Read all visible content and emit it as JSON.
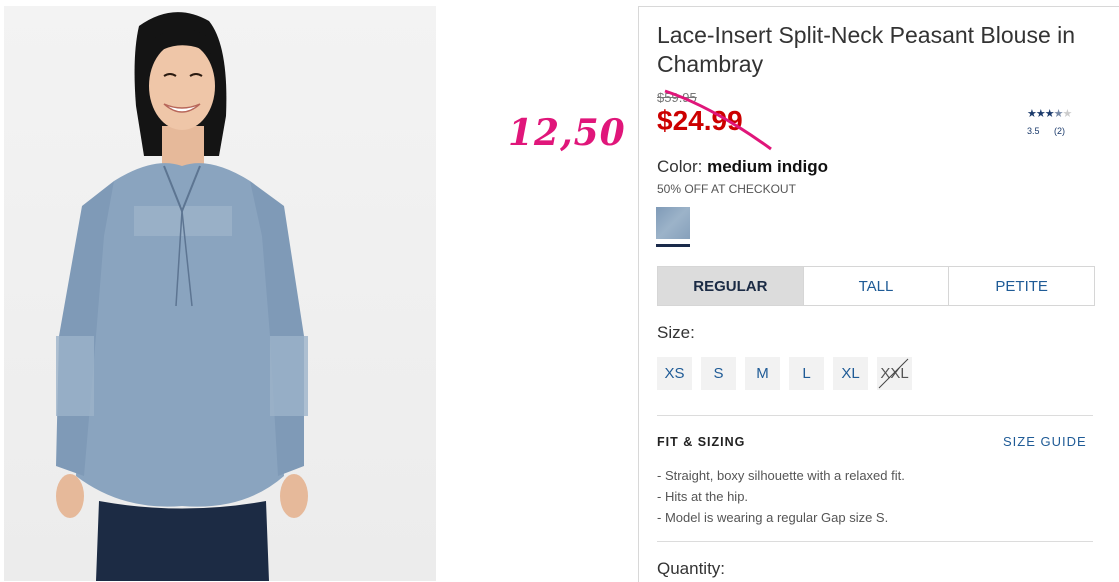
{
  "product": {
    "title": "Lace-Insert Split-Neck Peasant Blouse in Chambray",
    "original_price": "$59.95",
    "sale_price": "$24.99",
    "handwritten_price": "12,50",
    "rating": {
      "value": "3.5",
      "count": "(2)",
      "stars_filled": 3.5,
      "stars_total": 5
    },
    "color_label": "Color:",
    "color_name": "medium indigo",
    "promo": "50% OFF AT CHECKOUT"
  },
  "fit_tabs": [
    {
      "label": "REGULAR",
      "active": true
    },
    {
      "label": "TALL",
      "active": false
    },
    {
      "label": "PETITE",
      "active": false
    }
  ],
  "size": {
    "label": "Size:",
    "options": [
      {
        "label": "XS",
        "available": true
      },
      {
        "label": "S",
        "available": true
      },
      {
        "label": "M",
        "available": true
      },
      {
        "label": "L",
        "available": true
      },
      {
        "label": "XL",
        "available": true
      },
      {
        "label": "XXL",
        "available": false
      }
    ]
  },
  "fit_sizing": {
    "heading": "FIT & SIZING",
    "size_guide": "SIZE GUIDE",
    "bullets": [
      "- Straight, boxy silhouette with a relaxed fit.",
      "- Hits at the hip.",
      "- Model is wearing a regular Gap size S."
    ]
  },
  "quantity_label": "Quantity:",
  "colors": {
    "sale_red": "#cc0000",
    "link_blue": "#1f5b96",
    "annotation_pink": "#e0167a",
    "chambray": "#8aa4bf"
  }
}
